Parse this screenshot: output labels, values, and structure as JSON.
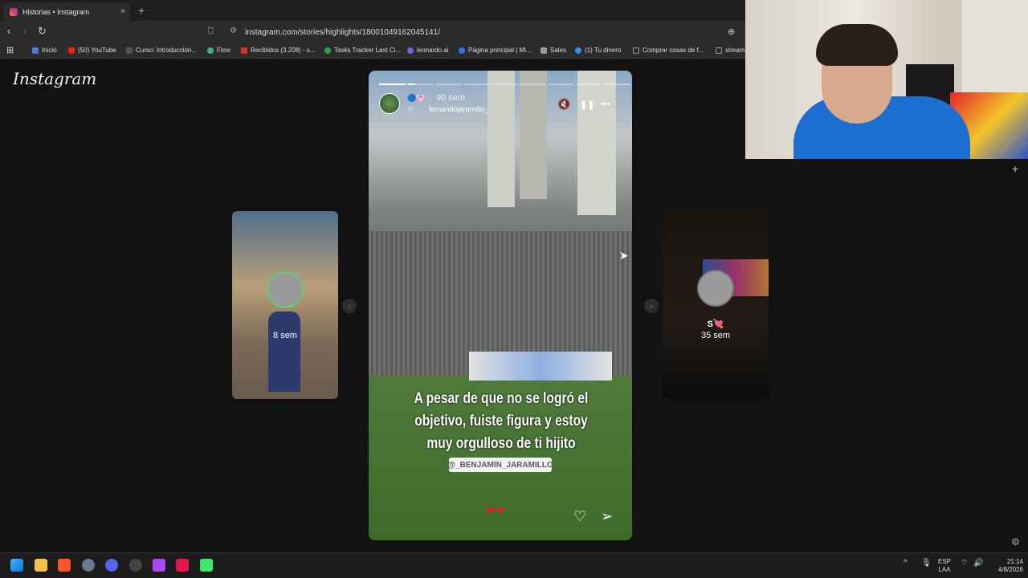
{
  "browser": {
    "tab_title": "Historias • Instagram",
    "tab_close": "×",
    "new_tab": "+",
    "url": "instagram.com/stories/highlights/18001049162045141/",
    "nav": {
      "back": "‹",
      "forward": "›",
      "reload": "↻",
      "bookmark": "⎕",
      "zoom": "⊕",
      "apps": "⊞"
    },
    "bookmarks": [
      {
        "label": "Inicio",
        "color": "#4a7bdc"
      },
      {
        "label": "(50) YouTube",
        "color": "#e62117"
      },
      {
        "label": "Curso: Introducción...",
        "color": "#555555"
      },
      {
        "label": "Flow",
        "color": "#36b37e"
      },
      {
        "label": "Recibidos (3.208) - s...",
        "color": "#d93025"
      },
      {
        "label": "Tasks Tracker Last Ci...",
        "color": "#2fa34a"
      },
      {
        "label": "leonardo.ai",
        "color": "#7b5ad6"
      },
      {
        "label": "Página principal | Mi...",
        "color": "#3b6cf0"
      },
      {
        "label": "Sales",
        "color": "#999999"
      },
      {
        "label": "(1) Tu dinero",
        "color": "#3c8ce7"
      },
      {
        "label": "Comprar cosas de f...",
        "color": "#888888"
      },
      {
        "label": "stream",
        "color": "#888888"
      }
    ]
  },
  "page": {
    "logo": "Instagram",
    "story": {
      "time": "90 sem",
      "username": "fernandojaramillo_",
      "caption_lines": [
        "A pesar de que no se logró el",
        "objetivo, fuiste figura y estoy",
        "muy orgulloso de ti hijito"
      ],
      "mention": "@_BENJAMIN_JARAMILLO",
      "hearts": "❤❤",
      "mute_icon": "🔇",
      "pause_icon": "❚❚",
      "more_icon": "•••",
      "like_icon": "♡",
      "share_icon": "➢",
      "segments": 9
    },
    "prev_story": {
      "label": "8 sem"
    },
    "next_story": {
      "name": "S💘",
      "label": "35 sem"
    },
    "prev_arrow": "‹",
    "next_arrow": "›"
  },
  "taskbar": {
    "lang_top": "ESP",
    "lang_bottom": "LAA",
    "time": "21:14",
    "date": "4/8/2026",
    "chevron": "^"
  },
  "colors": {
    "accent_ring": "#5fd06d",
    "heart": "#d31f2f"
  }
}
